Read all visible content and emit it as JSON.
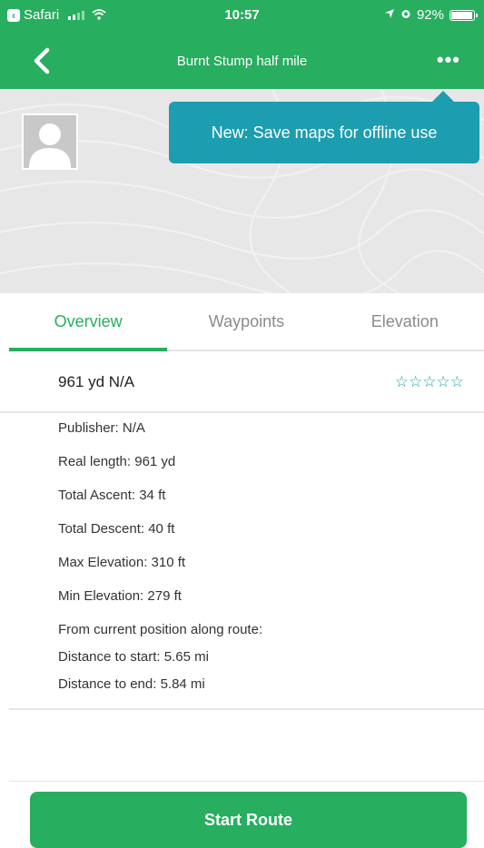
{
  "status_bar": {
    "back_app": "Safari",
    "time": "10:57",
    "battery": "92%",
    "icons": [
      "signal-icon",
      "wifi-icon",
      "location-arrow-icon",
      "alarm-icon",
      "battery-icon"
    ]
  },
  "nav": {
    "title": "Burnt Stump half mile",
    "back_icon": "chevron-left-icon",
    "more_label": "•••"
  },
  "tooltip": {
    "text": "New: Save maps for offline use"
  },
  "tabs": [
    {
      "label": "Overview",
      "active": true
    },
    {
      "label": "Waypoints",
      "active": false
    },
    {
      "label": "Elevation",
      "active": false
    }
  ],
  "summary": {
    "text": "961 yd  N/A",
    "rating_stars": "☆☆☆☆☆",
    "rating_value": 0,
    "rating_max": 5
  },
  "details": [
    "Publisher:  N/A",
    "Real length:  961 yd",
    "Total Ascent:  34 ft",
    "Total Descent:  40 ft",
    "Max Elevation:  310 ft",
    "Min Elevation:  279 ft",
    "From current position along route:",
    "Distance to start:  5.65 mi",
    "Distance to end:  5.84 mi"
  ],
  "actions": {
    "start_route": "Start Route"
  },
  "colors": {
    "brand_green": "#27ae5f",
    "tooltip_teal": "#1c9db0",
    "header_bg": "#e7e7e7"
  }
}
